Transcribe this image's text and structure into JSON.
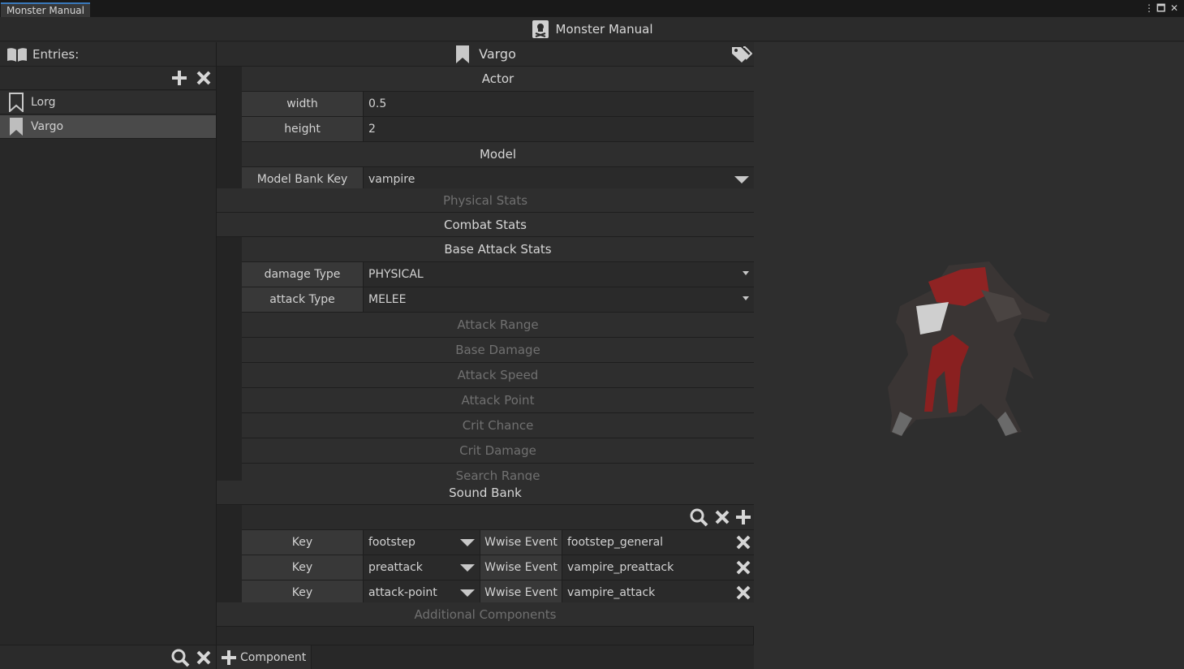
{
  "tab": {
    "label": "Monster Manual"
  },
  "window": {
    "title": "Monster Manual"
  },
  "entries": {
    "header": "Entries:",
    "items": [
      {
        "label": "Lorg",
        "selected": false
      },
      {
        "label": "Vargo",
        "selected": true
      }
    ]
  },
  "inspector": {
    "entry_name": "Vargo",
    "sections": {
      "actor": "Actor",
      "model": "Model",
      "physical_stats": "Physical Stats",
      "combat_stats": "Combat Stats",
      "base_attack_stats": "Base Attack Stats",
      "sound_bank": "Sound Bank",
      "additional_components": "Additional Components"
    },
    "actor_fields": [
      {
        "label": "width",
        "value": "0.5"
      },
      {
        "label": "height",
        "value": "2"
      }
    ],
    "model_fields": [
      {
        "label": "Model Bank Key",
        "value": "vampire"
      }
    ],
    "attack_fields": [
      {
        "label": "damage Type",
        "value": "PHYSICAL"
      },
      {
        "label": "attack Type",
        "value": "MELEE"
      }
    ],
    "attack_subsections": [
      "Attack Range",
      "Base Damage",
      "Attack Speed",
      "Attack Point",
      "Crit Chance",
      "Crit Damage",
      "Search Range"
    ],
    "sound_rows": [
      {
        "key_label": "Key",
        "key": "footstep",
        "event_label": "Wwise Event",
        "event": "footstep_general"
      },
      {
        "key_label": "Key",
        "key": "preattack",
        "event_label": "Wwise Event",
        "event": "vampire_preattack"
      },
      {
        "key_label": "Key",
        "key": "attack-point",
        "event_label": "Wwise Event",
        "event": "vampire_attack"
      }
    ]
  },
  "footer": {
    "component_button": "Component"
  },
  "colors": {
    "accent": "#3a79bb",
    "panel": "#282828",
    "label_bg": "#383838"
  }
}
